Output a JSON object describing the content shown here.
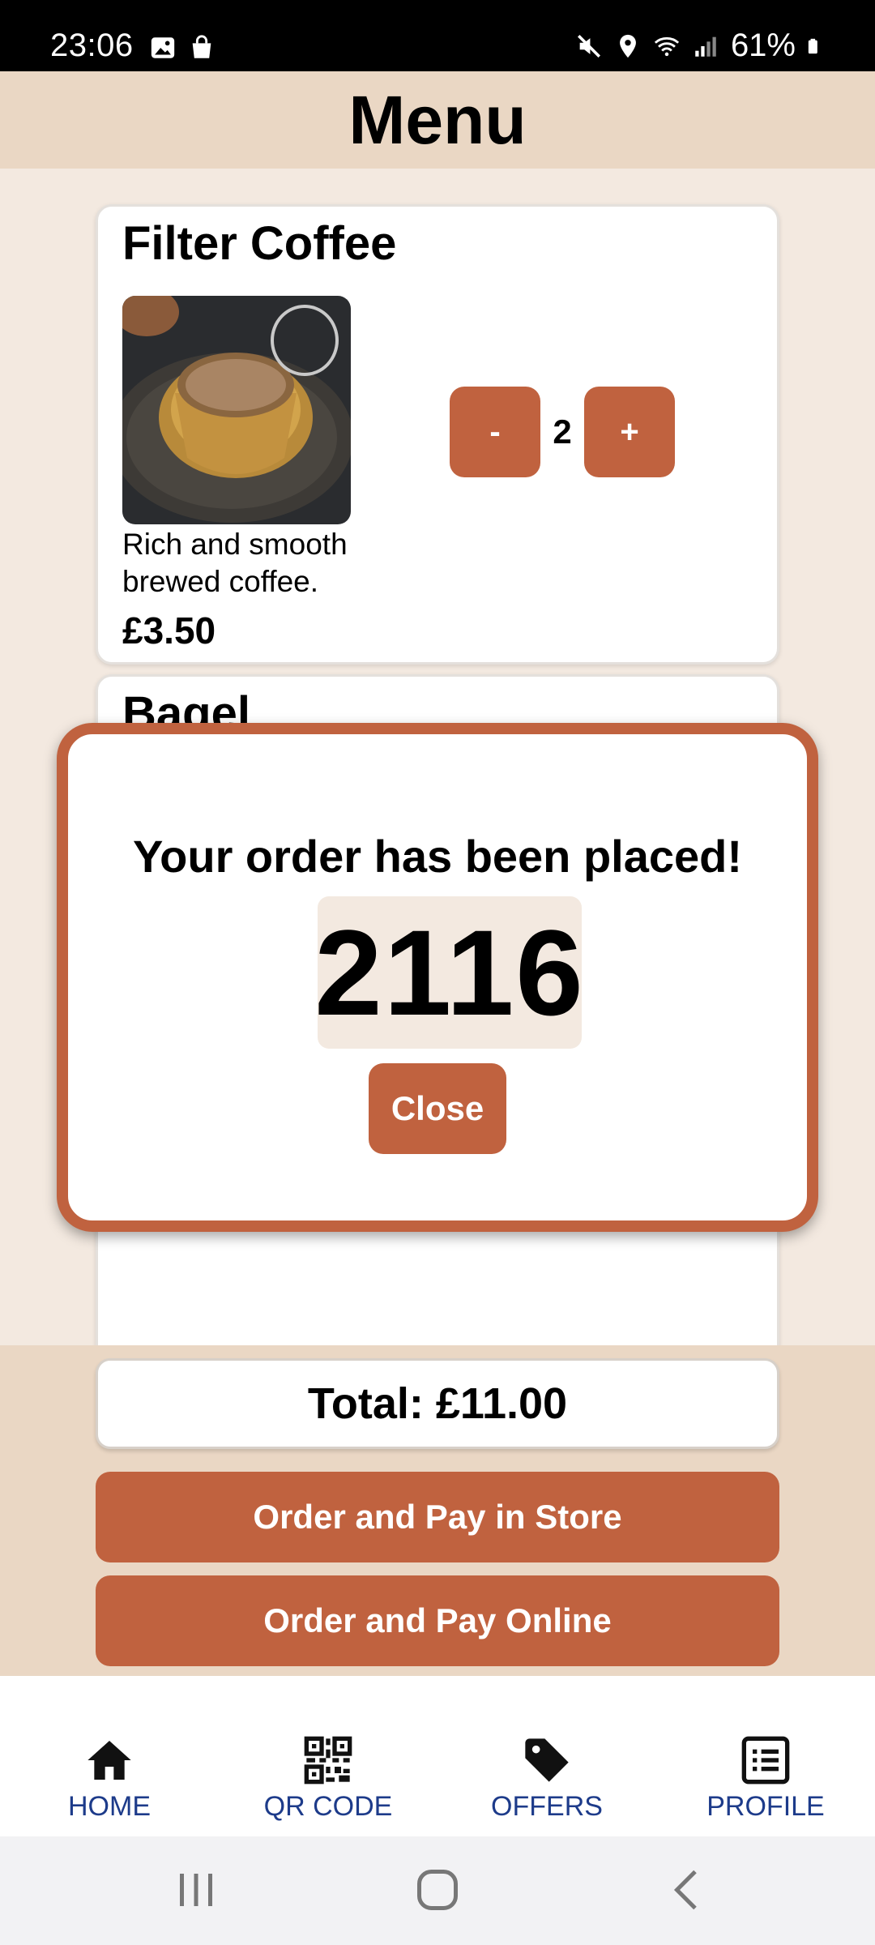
{
  "status_bar": {
    "time": "23:06",
    "battery": "61%",
    "left_icons": [
      "image-icon",
      "shopping-bag-icon"
    ],
    "right_icons": [
      "mute-icon",
      "location-icon",
      "wifi-icon",
      "signal-icon",
      "battery-icon"
    ]
  },
  "header": {
    "title": "Menu"
  },
  "menu": {
    "items": [
      {
        "title": "Filter Coffee",
        "description": "Rich and smooth brewed coffee.",
        "price": "£3.50",
        "quantity": "2",
        "minus_label": "-",
        "plus_label": "+"
      },
      {
        "title": "Bagel"
      }
    ]
  },
  "order_panel": {
    "total": "Total: £11.00",
    "pay_in_store": "Order and Pay in Store",
    "pay_online": "Order and Pay Online"
  },
  "modal": {
    "title": "Your order has been placed!",
    "order_number": "2116",
    "close_label": "Close"
  },
  "bottom_nav": {
    "items": [
      {
        "label": "HOME",
        "icon": "home-icon"
      },
      {
        "label": "QR CODE",
        "icon": "qr-code-icon"
      },
      {
        "label": "OFFERS",
        "icon": "tag-icon"
      },
      {
        "label": "PROFILE",
        "icon": "list-icon"
      }
    ]
  },
  "colors": {
    "accent": "#c0623f",
    "header_bg": "#ead7c4",
    "page_bg": "#f3e9e0",
    "nav_label": "#1d3b8a"
  }
}
